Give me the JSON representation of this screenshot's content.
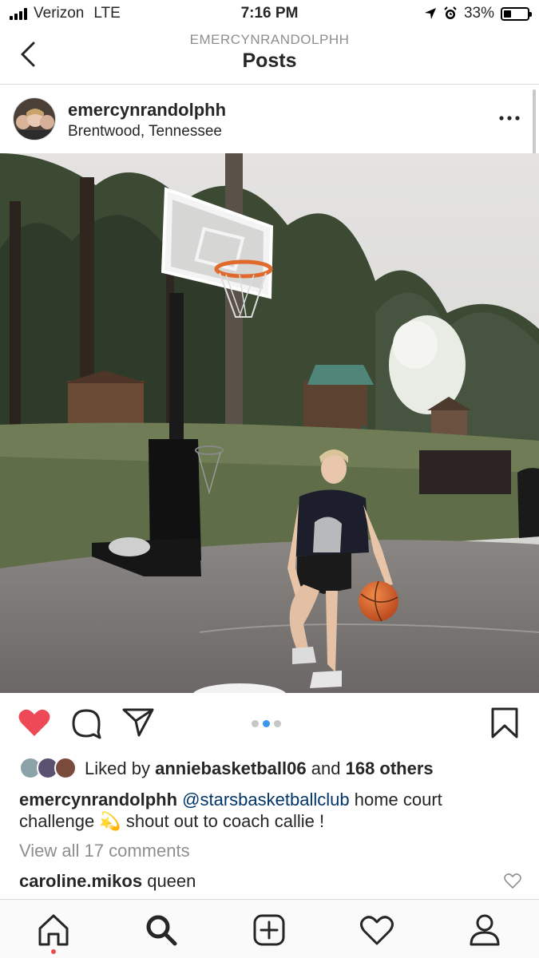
{
  "status_bar": {
    "carrier": "Verizon",
    "network": "LTE",
    "time": "7:16 PM",
    "battery_text": "33%",
    "battery_level": 0.33
  },
  "header": {
    "subtitle": "EMERCYNRANDOLPHH",
    "title": "Posts"
  },
  "post": {
    "username": "emercynrandolphh",
    "location": "Brentwood, Tennessee",
    "carousel": {
      "count": 3,
      "active": 1
    },
    "likes": {
      "prefix": "Liked by",
      "user": "anniebasketball06",
      "middle": "and",
      "others": "168 others"
    },
    "caption": {
      "username": "emercynrandolphh",
      "mention": "@starsbasketballclub",
      "text_1": " home court",
      "text_2": "challenge",
      "emoji": "💫",
      "text_3": " shout out to coach callie !"
    },
    "view_all_comments": "View all 17 comments",
    "comment": {
      "username": "caroline.mikos",
      "text": "queen"
    }
  },
  "colors": {
    "like_red": "#ed4956",
    "carousel_active": "#3897f0",
    "mention": "#003569",
    "muted": "#8e8e8e"
  },
  "icons": [
    "back-chevron-icon",
    "more-options-icon",
    "heart-filled-icon",
    "comment-icon",
    "share-icon",
    "bookmark-icon",
    "comment-heart-icon",
    "home-icon",
    "search-icon",
    "add-post-icon",
    "activity-heart-icon",
    "profile-icon"
  ]
}
